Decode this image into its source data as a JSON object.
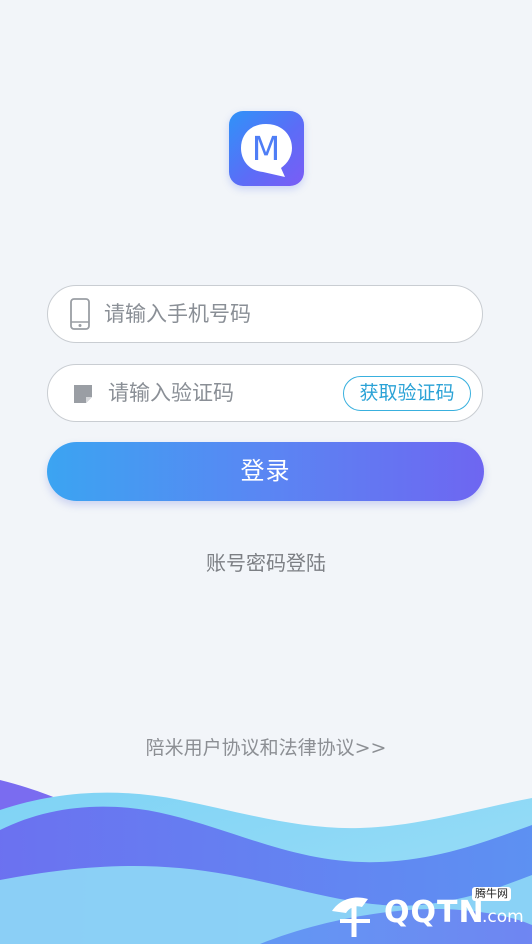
{
  "app": {
    "logo_letter": "M"
  },
  "login_form": {
    "phone_placeholder": "请输入手机号码",
    "code_placeholder": "请输入验证码",
    "get_code_label": "获取验证码",
    "submit_label": "登录"
  },
  "links": {
    "account_login": "账号密码登陆",
    "agreement": "陪米用户协议和法律协议>>"
  },
  "watermark": {
    "text": "QQTN",
    "domain": ".com",
    "badge": "腾牛网"
  },
  "colors": {
    "accent_start": "#3ba4f2",
    "accent_end": "#6e66f1",
    "link_blue": "#2aa2d6",
    "background": "#f2f5f9"
  }
}
